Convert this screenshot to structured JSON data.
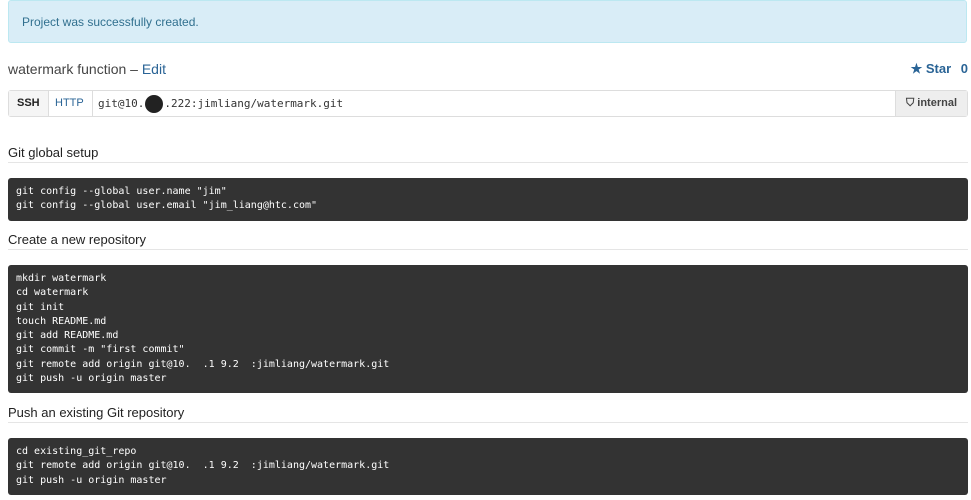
{
  "alert": {
    "text": "Project was successfully created."
  },
  "project": {
    "name": "watermark function –",
    "edit_label": "Edit"
  },
  "star": {
    "label": "Star",
    "count": "0"
  },
  "clone": {
    "tabs": [
      "SSH",
      "HTTP"
    ],
    "url_start": "git@10.",
    "url_end": ".222:jimliang/watermark.git",
    "visibility": "internal"
  },
  "sections": [
    {
      "heading": "Git global setup",
      "lines": [
        "git config --global user.name \"jim\"",
        "git config --global user.email \"jim_liang@htc.com\""
      ]
    },
    {
      "heading": "Create a new repository",
      "lines": [
        "mkdir watermark",
        "cd watermark",
        "git init",
        "touch README.md",
        "git add README.md",
        "git commit -m \"first commit\"",
        "git remote add origin git@10.  .1 9.2  :jimliang/watermark.git",
        "git push -u origin master"
      ]
    },
    {
      "heading": "Push an existing Git repository",
      "lines": [
        "cd existing_git_repo",
        "git remote add origin git@10.  .1 9.2  :jimliang/watermark.git",
        "git push -u origin master"
      ]
    }
  ]
}
